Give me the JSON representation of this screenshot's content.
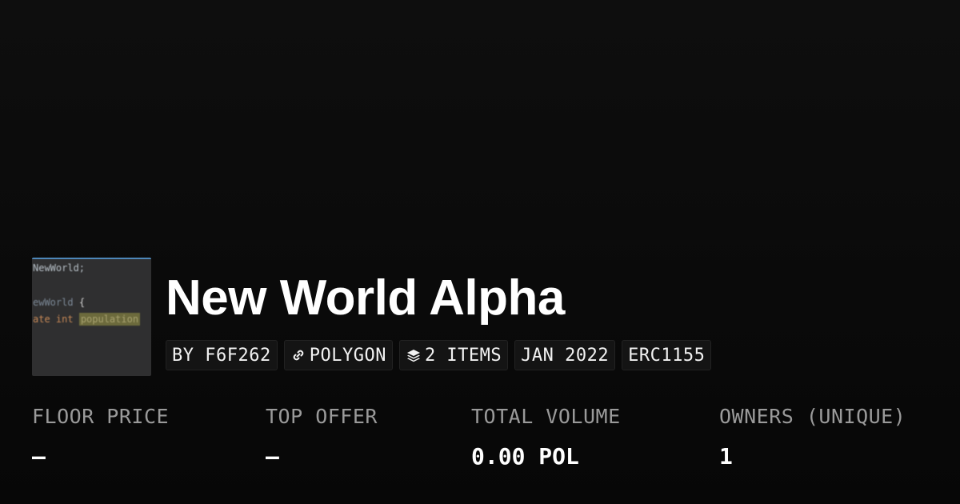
{
  "collection": {
    "title": "New World Alpha",
    "thumbnail": {
      "lines": [
        "NewWorld;",
        "ewWorld",
        "{",
        "ate int",
        "population"
      ]
    }
  },
  "badges": {
    "creator": "BY F6F262",
    "chain": "POLYGON",
    "chain_icon": "link-icon",
    "items": "2 ITEMS",
    "items_icon": "layers-icon",
    "date": "JAN 2022",
    "standard": "ERC1155"
  },
  "stats": {
    "floor_price": {
      "label": "FLOOR PRICE",
      "value": "–"
    },
    "top_offer": {
      "label": "TOP OFFER",
      "value": "–"
    },
    "total_volume": {
      "label": "TOTAL VOLUME",
      "value": "0.00 POL"
    },
    "owners": {
      "label": "OWNERS (UNIQUE)",
      "value": "1"
    }
  },
  "colors": {
    "background": "#0b0b0b",
    "badge_background": "#141414",
    "label": "#9a9a9a",
    "text": "#ffffff"
  }
}
